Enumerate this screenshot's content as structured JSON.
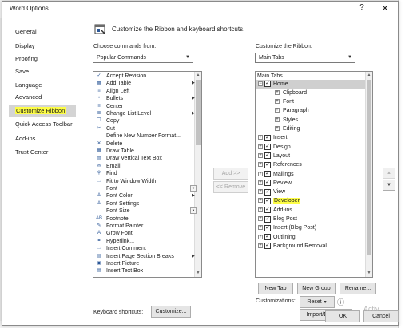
{
  "window": {
    "title": "Word Options",
    "help": "?",
    "close": "✕"
  },
  "nav": {
    "items": [
      {
        "label": "General"
      },
      {
        "label": "Display"
      },
      {
        "label": "Proofing"
      },
      {
        "label": "Save"
      },
      {
        "label": "Language"
      },
      {
        "label": "Advanced"
      },
      {
        "label": "Customize Ribbon"
      },
      {
        "label": "Quick Access Toolbar"
      },
      {
        "label": "Add-ins"
      },
      {
        "label": "Trust Center"
      }
    ],
    "active_index": 6,
    "highlight_color": "#fdfd46"
  },
  "header": {
    "title": "Customize the Ribbon and keyboard shortcuts."
  },
  "commands": {
    "label": "Choose commands from:",
    "selected": "Popular Commands",
    "items": [
      {
        "label": "Accept Revision",
        "icon": "accept-icon",
        "glyph": "✓"
      },
      {
        "label": "Add Table",
        "icon": "table-icon",
        "glyph": "▦",
        "submenu": true
      },
      {
        "label": "Align Left",
        "icon": "align-left-icon",
        "glyph": "≡"
      },
      {
        "label": "Bullets",
        "icon": "bullets-icon",
        "glyph": "•",
        "submenu": true
      },
      {
        "label": "Center",
        "icon": "center-icon",
        "glyph": "≡"
      },
      {
        "label": "Change List Level",
        "icon": "list-level-icon",
        "glyph": "≣",
        "submenu": true
      },
      {
        "label": "Copy",
        "icon": "copy-icon",
        "glyph": "❐"
      },
      {
        "label": "Cut",
        "icon": "cut-icon",
        "glyph": "✂"
      },
      {
        "label": "Define New Number Format...",
        "icon": "",
        "glyph": ""
      },
      {
        "label": "Delete",
        "icon": "delete-icon",
        "glyph": "✕"
      },
      {
        "label": "Draw Table",
        "icon": "draw-table-icon",
        "glyph": "▦"
      },
      {
        "label": "Draw Vertical Text Box",
        "icon": "text-box-icon",
        "glyph": "▤"
      },
      {
        "label": "Email",
        "icon": "email-icon",
        "glyph": "✉"
      },
      {
        "label": "Find",
        "icon": "find-icon",
        "glyph": "⚲"
      },
      {
        "label": "Fit to Window Width",
        "icon": "fit-width-icon",
        "glyph": "▭"
      },
      {
        "label": "Font",
        "icon": "",
        "glyph": "",
        "dropdown": true
      },
      {
        "label": "Font Color",
        "icon": "font-color-icon",
        "glyph": "A",
        "submenu": true
      },
      {
        "label": "Font Settings",
        "icon": "font-settings-icon",
        "glyph": "A"
      },
      {
        "label": "Font Size",
        "icon": "",
        "glyph": "",
        "dropdown": true
      },
      {
        "label": "Footnote",
        "icon": "footnote-icon",
        "glyph": "AB"
      },
      {
        "label": "Format Painter",
        "icon": "format-painter-icon",
        "glyph": "✎"
      },
      {
        "label": "Grow Font",
        "icon": "grow-font-icon",
        "glyph": "A"
      },
      {
        "label": "Hyperlink...",
        "icon": "hyperlink-icon",
        "glyph": "⚭"
      },
      {
        "label": "Insert Comment",
        "icon": "comment-icon",
        "glyph": "▭"
      },
      {
        "label": "Insert Page  Section Breaks",
        "icon": "break-icon",
        "glyph": "▤",
        "submenu": true
      },
      {
        "label": "Insert Picture",
        "icon": "picture-icon",
        "glyph": "▣"
      },
      {
        "label": "Insert Text Box",
        "icon": "text-box-icon",
        "glyph": "▤"
      }
    ]
  },
  "ribbon": {
    "label": "Customize the Ribbon:",
    "selected": "Main Tabs",
    "header": "Main Tabs",
    "home": {
      "label": "Home",
      "groups": [
        "Clipboard",
        "Font",
        "Paragraph",
        "Styles",
        "Editing"
      ]
    },
    "tabs": [
      {
        "label": "Insert"
      },
      {
        "label": "Design"
      },
      {
        "label": "Layout"
      },
      {
        "label": "References"
      },
      {
        "label": "Mailings"
      },
      {
        "label": "Review"
      },
      {
        "label": "View"
      },
      {
        "label": "Developer",
        "highlight": true
      },
      {
        "label": "Add-ins"
      },
      {
        "label": "Blog Post"
      },
      {
        "label": "Insert (Blog Post)"
      },
      {
        "label": "Outlining"
      },
      {
        "label": "Background Removal"
      }
    ]
  },
  "buttons": {
    "add": "Add >>",
    "remove": "<< Remove",
    "new_tab": "New Tab",
    "new_group": "New Group",
    "rename": "Rename...",
    "customizations_label": "Customizations:",
    "reset": "Reset",
    "import_export": "Import/Export",
    "keyboard_label": "Keyboard shortcuts:",
    "customize": "Customize...",
    "ok": "OK",
    "cancel": "Cancel",
    "info": "ⓘ"
  },
  "watermark": "Activ"
}
